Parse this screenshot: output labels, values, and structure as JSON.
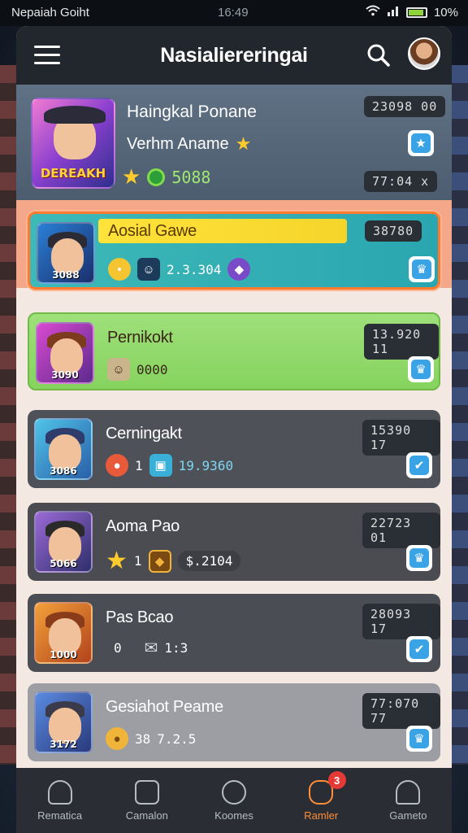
{
  "status_bar": {
    "carrier": "Nepaiah Goiht",
    "time": "16:49",
    "battery": "10%"
  },
  "header": {
    "title": "Nasialiereringai",
    "menu_icon": "menu-icon",
    "search_icon": "search-icon"
  },
  "featured": {
    "title": "Haingkal Ponane",
    "subtitle": "Verhm Aname",
    "score": "5088",
    "thumb_logo": "DEREAKH",
    "pill_top": "23098 00",
    "pill_bottom": "77:04 x"
  },
  "rows": [
    {
      "name": "Aosial Gawe",
      "level": "3088",
      "pill": "38780",
      "value": "2.3.304"
    },
    {
      "name": "Pernikokt",
      "level": "3090",
      "pill": "13.920 11",
      "value": "0000"
    },
    {
      "name": "Cerningakt",
      "level": "3086",
      "pill": "15390 17",
      "count": "1",
      "value": "19.9360"
    },
    {
      "name": "Aoma Pao",
      "level": "5066",
      "pill": "22723 01",
      "count": "1",
      "value": "$.2104"
    },
    {
      "name": "Pas Bcao",
      "level": "1000",
      "pill": "28093 17",
      "count": "0",
      "value": "1:3"
    },
    {
      "name": "Gesiahot Peame",
      "level": "3172",
      "pill": "77:070 77",
      "count": "38",
      "value": "7.2.5"
    }
  ],
  "bottom_nav": [
    {
      "label": "Rematica",
      "icon": "home-icon"
    },
    {
      "label": "Camalon",
      "icon": "camera-icon"
    },
    {
      "label": "Koomes",
      "icon": "search-icon"
    },
    {
      "label": "Ramler",
      "icon": "chat-icon",
      "badge": "3"
    },
    {
      "label": "Gameto",
      "icon": "profile-icon"
    }
  ],
  "colors": {
    "accent": "#ff8f3a",
    "highlight_border": "#ff7a2e",
    "badge": "#e53935"
  }
}
